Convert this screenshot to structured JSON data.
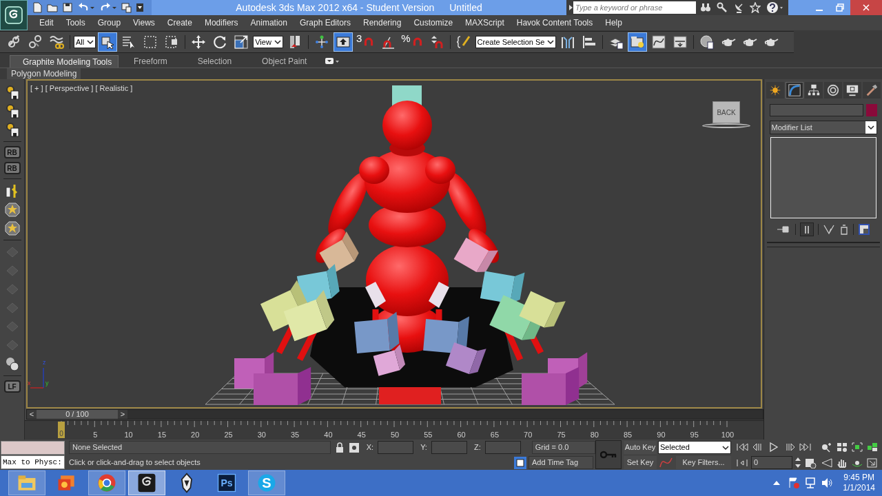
{
  "window": {
    "title": "Autodesk 3ds Max  2012 x64  - Student Version",
    "document": "Untitled"
  },
  "search": {
    "placeholder": "Type a keyword or phrase"
  },
  "menu": [
    "Edit",
    "Tools",
    "Group",
    "Views",
    "Create",
    "Modifiers",
    "Animation",
    "Graph Editors",
    "Rendering",
    "Customize",
    "MAXScript",
    "Havok Content Tools",
    "Help"
  ],
  "toolbar": [
    [
      {
        "kind": "link",
        "selected": false
      },
      {
        "kind": "unlink",
        "selected": false
      },
      {
        "kind": "bind",
        "selected": false
      }
    ],
    [
      {
        "kind": "dropdown",
        "value": "All",
        "selected": false
      },
      {
        "kind": "select",
        "selected": true
      },
      {
        "kind": "select-name",
        "selected": false
      },
      {
        "kind": "region",
        "selected": false
      },
      {
        "kind": "crossing",
        "selected": false
      }
    ],
    [
      {
        "kind": "move",
        "selected": false
      },
      {
        "kind": "rotate",
        "selected": false
      },
      {
        "kind": "scale",
        "selected": false
      },
      {
        "kind": "dropdown",
        "value": "View",
        "selected": false
      },
      {
        "kind": "pivot",
        "selected": false
      }
    ],
    [
      {
        "kind": "manipulate",
        "selected": false
      },
      {
        "kind": "keyboard",
        "selected": true
      },
      {
        "kind": "snap",
        "label": "3",
        "selected": false
      },
      {
        "kind": "angle-snap",
        "selected": false
      },
      {
        "kind": "snap",
        "label": "%",
        "selected": false
      },
      {
        "kind": "spinner-snap",
        "selected": false
      }
    ],
    [
      {
        "kind": "named-sets",
        "selected": false
      },
      {
        "kind": "dropdown",
        "value": "Create Selection Se",
        "selected": false
      },
      {
        "kind": "mirror",
        "selected": false
      },
      {
        "kind": "align",
        "selected": false
      }
    ],
    [
      {
        "kind": "layers",
        "selected": false
      },
      {
        "kind": "explorer",
        "selected": true
      },
      {
        "kind": "curve",
        "selected": false
      },
      {
        "kind": "schematic",
        "selected": false
      }
    ],
    [
      {
        "kind": "material",
        "selected": false
      },
      {
        "kind": "teapot",
        "selected": false
      },
      {
        "kind": "teapot",
        "selected": false
      },
      {
        "kind": "teapot",
        "selected": false
      }
    ]
  ],
  "ribbon": {
    "tabs": [
      {
        "label": "Graphite Modeling Tools",
        "selected": true
      },
      {
        "label": "Freeform",
        "selected": false
      },
      {
        "label": "Selection",
        "selected": false
      },
      {
        "label": "Object Paint",
        "selected": false
      }
    ],
    "panel": "Polygon Modeling"
  },
  "left_toolbar": [
    [
      {
        "kind": "gear",
        "disabled": false
      },
      {
        "kind": "gear",
        "disabled": false
      },
      {
        "kind": "gear",
        "disabled": false
      }
    ],
    [
      {
        "kind": "label",
        "label": "RB",
        "disabled": false
      },
      {
        "kind": "label",
        "label": "RB",
        "disabled": false
      }
    ],
    [
      {
        "kind": "ruler",
        "disabled": false
      },
      {
        "kind": "star",
        "disabled": false
      },
      {
        "kind": "star",
        "disabled": false
      }
    ],
    [
      {
        "kind": "shape",
        "disabled": true
      },
      {
        "kind": "shape",
        "disabled": true
      },
      {
        "kind": "shape",
        "disabled": true
      },
      {
        "kind": "shape",
        "disabled": true
      },
      {
        "kind": "shape",
        "disabled": true
      },
      {
        "kind": "shape",
        "disabled": true
      },
      {
        "kind": "blob",
        "disabled": false
      }
    ],
    [
      {
        "kind": "label",
        "label": "LF",
        "disabled": false
      }
    ]
  ],
  "viewport": {
    "label": "[ + ] [ Perspective ] [ Realistic ]",
    "viewcube": "BACK",
    "axes": [
      "z",
      "x",
      "y"
    ]
  },
  "command_panel": {
    "tabs": [
      {
        "selected": false
      },
      {
        "selected": true
      },
      {
        "selected": false
      },
      {
        "selected": false
      },
      {
        "selected": false
      },
      {
        "selected": false
      }
    ],
    "modifier_list": "Modifier List"
  },
  "time_slider": {
    "counter": "0 / 100",
    "prev": "<",
    "next": ">",
    "level": 0
  },
  "track_bar": {
    "ticks": [
      "0",
      "5",
      "10",
      "15",
      "20",
      "25",
      "30",
      "35",
      "40",
      "45",
      "50",
      "55",
      "60",
      "65",
      "70",
      "75",
      "80",
      "85",
      "90",
      "95",
      "100"
    ]
  },
  "status": {
    "listener": "Max to Physc:",
    "selection": "None Selected",
    "prompt": "Click or click-and-drag to select objects",
    "coords": [
      "X:",
      "Y:",
      "Z:"
    ],
    "grid": "Grid = 0.0",
    "time_tag": "Add Time Tag",
    "auto_key": "Auto Key",
    "key_mode": "Selected",
    "set_key": "Set Key",
    "key_filters": "Key Filters...",
    "frame": "0"
  },
  "taskbar": {
    "apps": [
      {
        "kind": "folder",
        "running": true,
        "selected": false
      },
      {
        "kind": "photos",
        "running": false,
        "selected": false
      },
      {
        "kind": "chrome",
        "running": true,
        "selected": false
      },
      {
        "kind": "max",
        "running": true,
        "selected": true
      },
      {
        "kind": "dragon",
        "running": false,
        "selected": false
      },
      {
        "kind": "ps",
        "label": "Ps",
        "running": false,
        "selected": false
      },
      {
        "kind": "skype",
        "label": "S",
        "running": true,
        "selected": false
      }
    ],
    "time": "9:45 PM",
    "date": "1/1/2014"
  }
}
